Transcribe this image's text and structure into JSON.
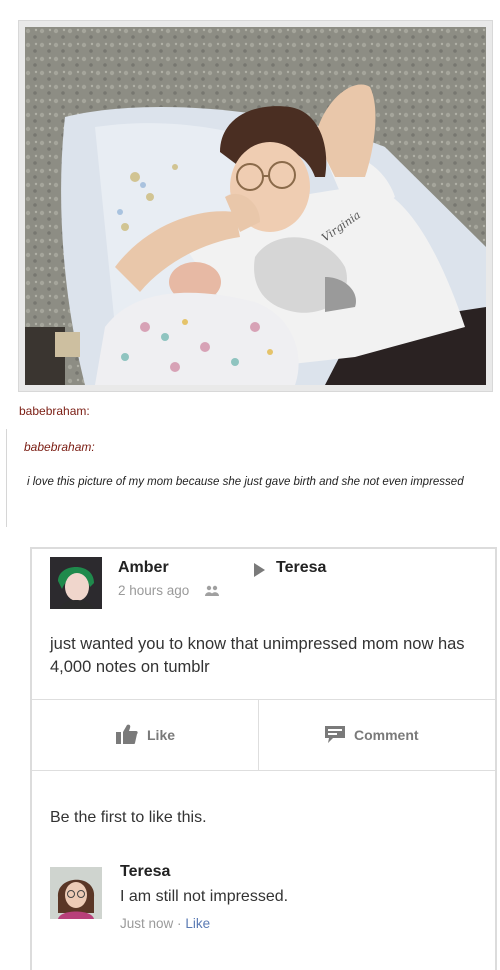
{
  "post": {
    "username": "babebraham:",
    "photo": {
      "name": "mom-with-newborn-photo",
      "shirt_text": "Virginia"
    }
  },
  "quote": {
    "username": "babebraham:",
    "text": "i love this picture of my mom because she just gave birth and she not even impressed"
  },
  "facebook_post": {
    "author": "Amber",
    "target": "Teresa",
    "time": "2 hours ago",
    "body": "just wanted you to know that unimpressed mom now has 4,000 notes on tumblr",
    "actions": {
      "like_label": "Like",
      "comment_label": "Comment"
    },
    "likes_text": "Be the first to like this.",
    "reply": {
      "author": "Teresa",
      "text": "I am still not impressed.",
      "time": "Just now",
      "separator": "·",
      "like_label": "Like"
    }
  },
  "icons": {
    "arrow": "right-arrow-icon",
    "friends": "friends-icon",
    "like": "thumbs-up-icon",
    "comment": "comment-bubble-icon"
  },
  "colors": {
    "username": "#7a1c12",
    "link_blue": "#5b7bb4",
    "muted_gray": "#9a9a9a"
  }
}
